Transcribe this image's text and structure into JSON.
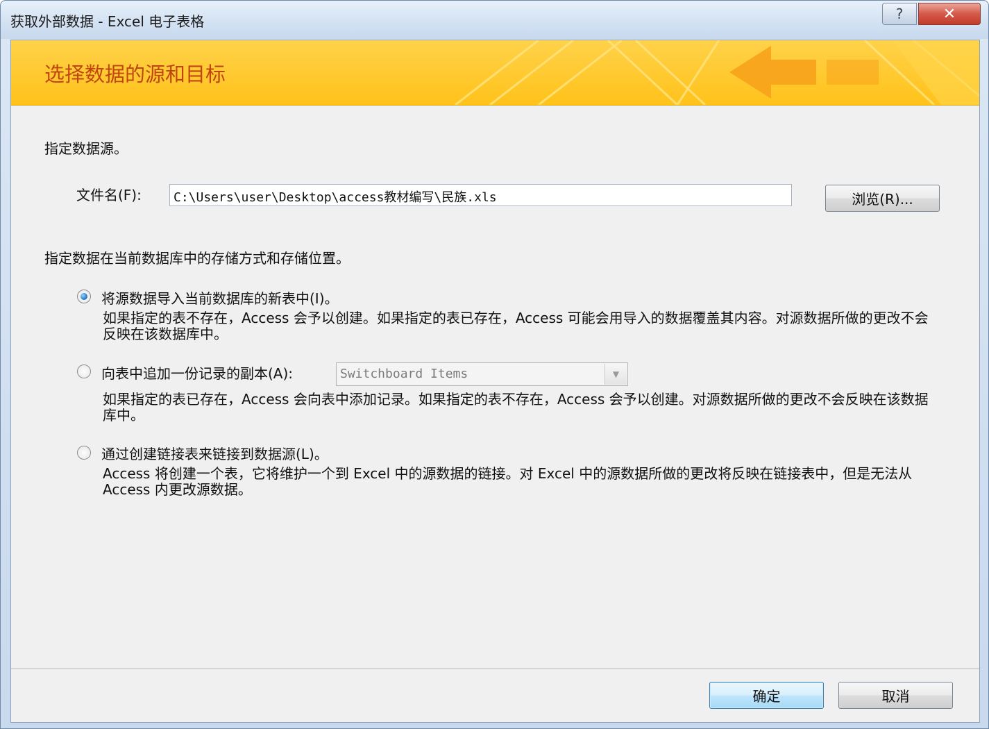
{
  "window": {
    "title": "获取外部数据 - Excel 电子表格",
    "help_glyph": "?",
    "close_glyph": "✕"
  },
  "banner": {
    "title": "选择数据的源和目标",
    "color": "#ffc21a"
  },
  "source": {
    "heading": "指定数据源。",
    "file_label": "文件名(F):",
    "file_value": "C:\\Users\\user\\Desktop\\access教材编写\\民族.xls",
    "browse_label": "浏览(R)..."
  },
  "storage": {
    "heading": "指定数据在当前数据库中的存储方式和存储位置。",
    "options": [
      {
        "label": "将源数据导入当前数据库的新表中(I)。",
        "description": "如果指定的表不存在，Access 会予以创建。如果指定的表已存在，Access 可能会用导入的数据覆盖其内容。对源数据所做的更改不会反映在该数据库中。",
        "checked": true
      },
      {
        "label": "向表中追加一份记录的副本(A):",
        "description": "如果指定的表已存在，Access 会向表中添加记录。如果指定的表不存在，Access 会予以创建。对源数据所做的更改不会反映在该数据库中。",
        "checked": false,
        "combo_value": "Switchboard Items"
      },
      {
        "label": "通过创建链接表来链接到数据源(L)。",
        "description": "Access 将创建一个表，它将维护一个到 Excel 中的源数据的链接。对 Excel 中的源数据所做的更改将反映在链接表中，但是无法从 Access 内更改源数据。",
        "checked": false
      }
    ]
  },
  "footer": {
    "ok_label": "确定",
    "cancel_label": "取消"
  }
}
